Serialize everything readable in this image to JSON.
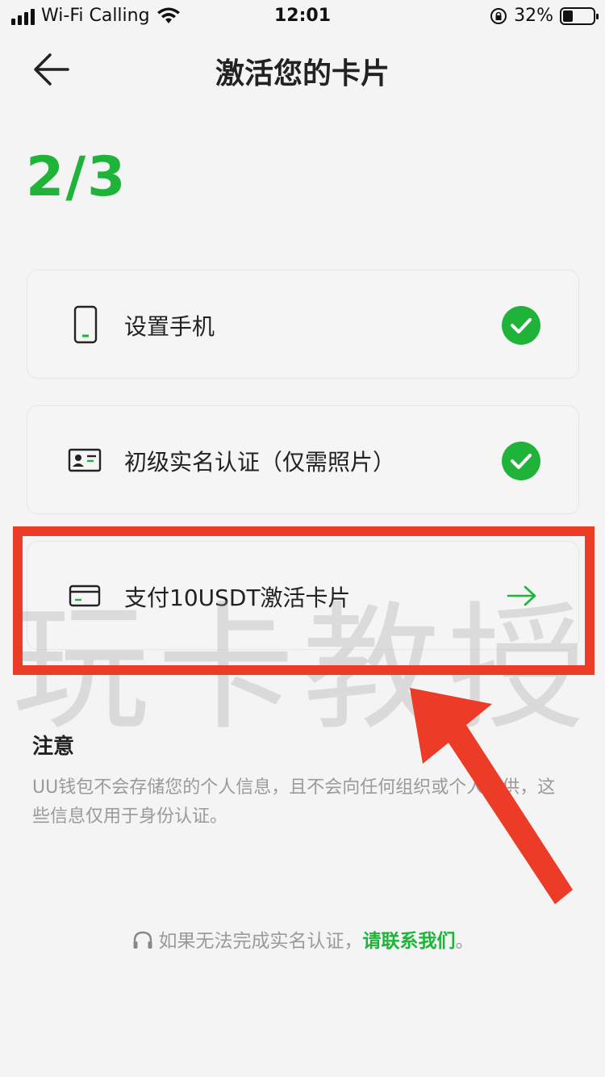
{
  "status_bar": {
    "carrier": "Wi-Fi Calling",
    "time": "12:01",
    "battery": "32%",
    "battery_level": 0.32
  },
  "nav": {
    "title": "激活您的卡片",
    "back_icon": "arrow-left-icon"
  },
  "progress": {
    "text": "2/3"
  },
  "steps": [
    {
      "label": "设置手机",
      "icon": "phone-icon",
      "status": "done"
    },
    {
      "label": "初级实名认证（仅需照片）",
      "icon": "id-card-icon",
      "status": "done"
    },
    {
      "label": "支付10USDT激活卡片",
      "icon": "card-icon",
      "status": "pending"
    }
  ],
  "notice": {
    "title": "注意",
    "body": "UU钱包不会存储您的个人信息，且不会向任何组织或个人提供，这些信息仅用于身份认证。"
  },
  "contact": {
    "prefix": "如果无法完成实名认证，",
    "link": "请联系我们",
    "suffix": "。"
  },
  "watermark": "玩卡教授",
  "colors": {
    "accent": "#1fb33a",
    "highlight": "#ec3b26",
    "background": "#f4f4f4"
  }
}
